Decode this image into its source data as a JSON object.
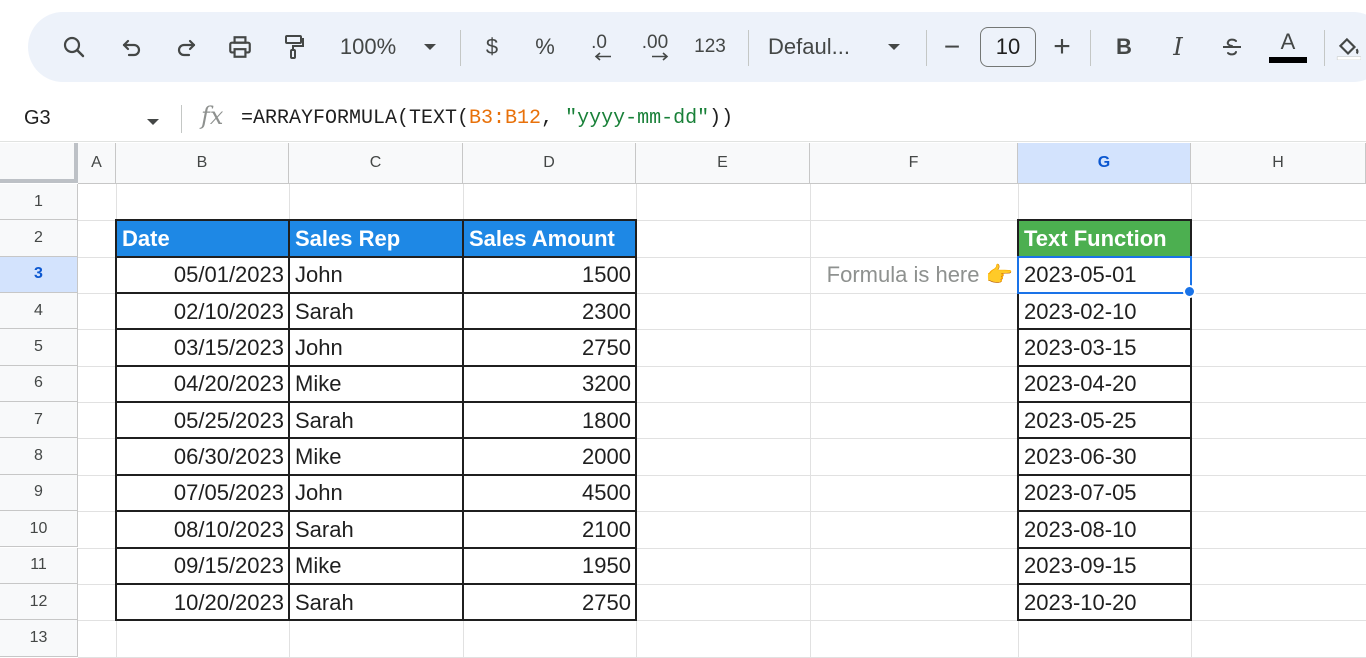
{
  "toolbar": {
    "zoom": "100%",
    "currency": "$",
    "percent": "%",
    "decrease_decimals": ".0",
    "increase_decimals": ".00",
    "more_formats": "123",
    "font": "Defaul...",
    "font_size": "10",
    "decrease_font_size": "−",
    "increase_font_size": "+",
    "bold": "B",
    "italic": "I",
    "text_color": "A"
  },
  "formula_bar": {
    "name_box": "G3",
    "fx": "fx",
    "formula_prefix": "=ARRAYFORMULA(TEXT(",
    "formula_ref": "B3:B12",
    "formula_sep": ", ",
    "formula_str": "\"yyyy-mm-dd\"",
    "formula_suffix": "))"
  },
  "columns": [
    "A",
    "B",
    "C",
    "D",
    "E",
    "F",
    "G",
    "H"
  ],
  "rows": [
    "1",
    "2",
    "3",
    "4",
    "5",
    "6",
    "7",
    "8",
    "9",
    "10",
    "11",
    "12",
    "13"
  ],
  "selected": {
    "column": "G",
    "row": "3"
  },
  "table": {
    "headers": [
      "Date",
      "Sales Rep",
      "Sales Amount"
    ],
    "rows": [
      [
        "05/01/2023",
        "John",
        "1500"
      ],
      [
        "02/10/2023",
        "Sarah",
        "2300"
      ],
      [
        "03/15/2023",
        "John",
        "2750"
      ],
      [
        "04/20/2023",
        "Mike",
        "3200"
      ],
      [
        "05/25/2023",
        "Sarah",
        "1800"
      ],
      [
        "06/30/2023",
        "Mike",
        "2000"
      ],
      [
        "07/05/2023",
        "John",
        "4500"
      ],
      [
        "08/10/2023",
        "Sarah",
        "2100"
      ],
      [
        "09/15/2023",
        "Mike",
        "1950"
      ],
      [
        "10/20/2023",
        "Sarah",
        "2750"
      ]
    ]
  },
  "note": "Formula is here 👉",
  "result": {
    "header": "Text Function",
    "values": [
      "2023-05-01",
      "2023-02-10",
      "2023-03-15",
      "2023-04-20",
      "2023-05-25",
      "2023-06-30",
      "2023-07-05",
      "2023-08-10",
      "2023-09-15",
      "2023-10-20"
    ]
  },
  "colors": {
    "table_header": "#1e88e5",
    "result_header": "#4caf50",
    "selection": "#1a73e8",
    "toolbar_bg": "#edf2fa"
  }
}
